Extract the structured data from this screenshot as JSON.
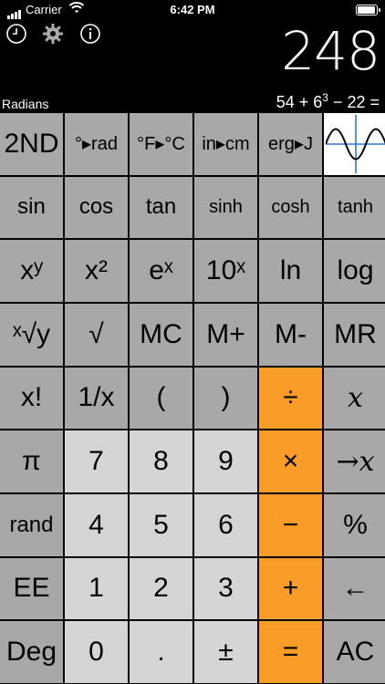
{
  "status": {
    "carrier": "Carrier",
    "time": "6:42 PM",
    "battery_level": 0.95
  },
  "toolbar": {
    "icons": [
      "clock-icon",
      "gear-icon",
      "info-icon"
    ]
  },
  "display": {
    "value": "248",
    "mode": "Radians",
    "expression_prefix": "54 + 6",
    "expression_exp": "3",
    "expression_suffix": " − 22 ="
  },
  "rows": [
    [
      "2ND",
      "°▸rad",
      "°F▸°C",
      "in▸cm",
      "erg▸J",
      "graph"
    ],
    [
      "sin",
      "cos",
      "tan",
      "sinh",
      "cosh",
      "tanh"
    ],
    [
      "xʸ",
      "x²",
      "eˣ",
      "10ˣ",
      "ln",
      "log"
    ],
    [
      "ˣ√y",
      "√",
      "MC",
      "M+",
      "M-",
      "MR"
    ],
    [
      "x!",
      "1/x",
      "(",
      ")",
      "÷",
      "x"
    ],
    [
      "π",
      "7",
      "8",
      "9",
      "×",
      "→x"
    ],
    [
      "rand",
      "4",
      "5",
      "6",
      "−",
      "%"
    ],
    [
      "EE",
      "1",
      "2",
      "3",
      "+",
      "←"
    ],
    [
      "Deg",
      "0",
      ".",
      "±",
      "=",
      "AC"
    ]
  ],
  "colors": {
    "accent": "#f99d28",
    "key_gray": "#a8a8a8",
    "key_light": "#d5d5d5"
  }
}
